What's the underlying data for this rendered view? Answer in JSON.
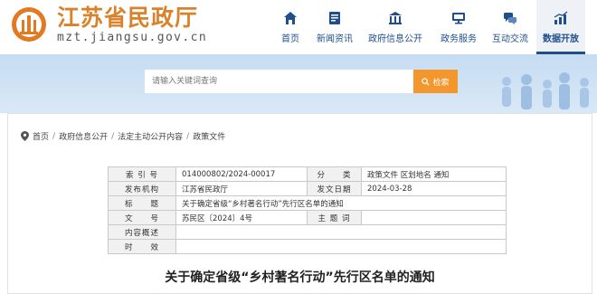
{
  "header": {
    "site_title": "江苏省民政厅",
    "domain": "mzt.jiangsu.gov.cn",
    "nav": [
      {
        "label": "首页",
        "icon": "home-icon"
      },
      {
        "label": "新闻资讯",
        "icon": "news-icon"
      },
      {
        "label": "政府信息公开",
        "icon": "bank-icon"
      },
      {
        "label": "政务服务",
        "icon": "monitor-icon"
      },
      {
        "label": "互动交流",
        "icon": "chat-icon"
      },
      {
        "label": "数据开放",
        "icon": "bar-chart-icon",
        "active": true
      }
    ]
  },
  "search": {
    "placeholder": "请输入关键词查询",
    "button_label": "检索"
  },
  "breadcrumb": [
    "首页",
    "政府信息公开",
    "法定主动公开内容",
    "政策文件"
  ],
  "meta": {
    "row1": {
      "k1": "索 引 号",
      "v1": "014000802/2024-00017",
      "k2": "分　　类",
      "v2": "政策文件 区划地名 通知"
    },
    "row2": {
      "k1": "发布机构",
      "v1": "江苏省民政厅",
      "k2": "发文日期",
      "v2": "2024-03-28"
    },
    "row3": {
      "k1": "标　　题",
      "v1": "关于确定省级“乡村著名行动”先行区名单的通知"
    },
    "row4": {
      "k1": "文　　号",
      "v1": "苏民区〔2024〕4号",
      "k2": "主 题 词",
      "v2": ""
    },
    "row5": {
      "k1": "内容概述",
      "v1": ""
    },
    "row6": {
      "k1": "时　　效",
      "v1": ""
    }
  },
  "document_title": "关于确定省级“乡村著名行动”先行区名单的通知",
  "colors": {
    "brand_orange": "#d9822b",
    "nav_blue": "#1f4e8c",
    "search_orange": "#f3962b"
  }
}
